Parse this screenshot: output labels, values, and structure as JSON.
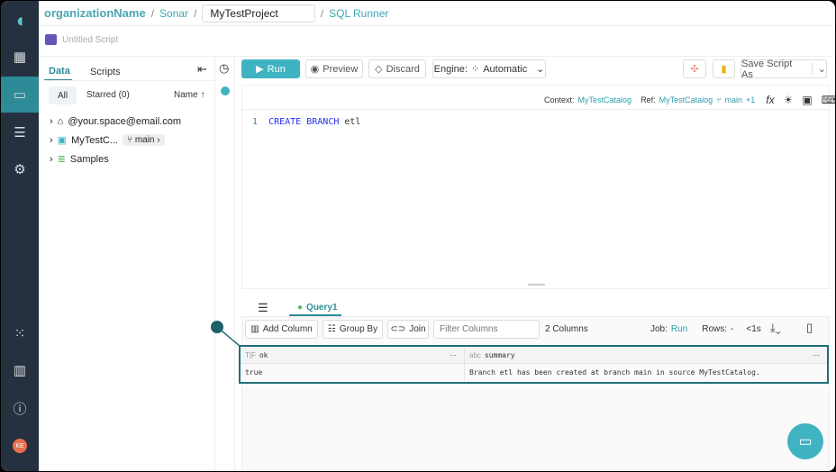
{
  "breadcrumb": {
    "org": "organizationName",
    "sonar": "Sonar",
    "project": "MyTestProject",
    "page": "SQL Runner"
  },
  "script_title": "Untitled Script",
  "left_panel": {
    "tabs": [
      "Data",
      "Scripts"
    ],
    "filters": {
      "all": "All",
      "starred": "Starred (0)",
      "sort": "Name ↑"
    },
    "tree": [
      {
        "label": "@your.space@email.com",
        "icon": "home-icon"
      },
      {
        "label": "MyTestC...",
        "icon": "catalog-icon",
        "branch": "main"
      },
      {
        "label": "Samples",
        "icon": "database-icon"
      }
    ]
  },
  "toolbar": {
    "run": "Run",
    "preview": "Preview",
    "discard": "Discard",
    "engine_label": "Engine:",
    "engine_value": "Automatic",
    "save": "Save Script As"
  },
  "context": {
    "context_label": "Context:",
    "context_value": "MyTestCatalog",
    "ref_label": "Ref:",
    "ref_value": "MyTestCatalog",
    "branch": "main",
    "extra": "+1"
  },
  "editor": {
    "line_number": "1",
    "keyword1": "CREATE",
    "keyword2": "BRANCH",
    "ident": "etl"
  },
  "results": {
    "tab": "Query1",
    "add_column": "Add Column",
    "group_by": "Group By",
    "join": "Join",
    "filter_placeholder": "Filter Columns",
    "columns_count": "2 Columns",
    "job_label": "Job:",
    "job_value": "Run",
    "rows_label": "Rows:",
    "rows_value": "-",
    "time": "<1s",
    "headers": [
      {
        "type": "T|F",
        "name": "ok"
      },
      {
        "type": "abc",
        "name": "summary"
      }
    ],
    "row": [
      "true",
      "Branch etl has been created at branch main in source MyTestCatalog."
    ]
  },
  "user_initials": "KE",
  "colors": {
    "accent": "#3fb3c2",
    "nav": "#25313f",
    "highlight": "#1f6f7a"
  }
}
